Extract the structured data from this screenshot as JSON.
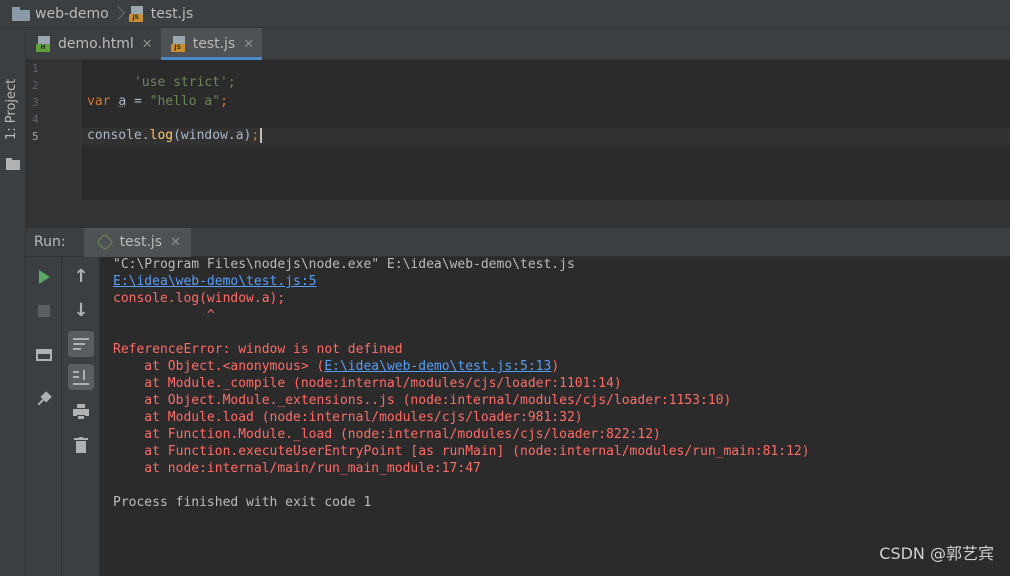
{
  "breadcrumb": {
    "project": "web-demo",
    "file": "test.js"
  },
  "left_strip": {
    "project_tab": "1: Project"
  },
  "editor_tabs": [
    {
      "label": "demo.html",
      "icon": "html-file-icon",
      "active": false
    },
    {
      "label": "test.js",
      "icon": "js-file-icon",
      "active": true
    }
  ],
  "editor": {
    "line_numbers": [
      "1",
      "2",
      "3",
      "4",
      "5"
    ],
    "current_line": "5",
    "lines": {
      "l1": "'use strict';",
      "l3_kw": "var",
      "l3_var": "a",
      "l3_op": " = ",
      "l3_str": "\"hello a\"",
      "l3_end": ";",
      "l5_obj": "console.",
      "l5_fn": "log",
      "l5_args": "(window.a)",
      "l5_end": ";"
    }
  },
  "run_panel": {
    "label": "Run:",
    "tab": "test.js",
    "toolbar_left": [
      "run-icon",
      "stop-icon",
      "layout-icon",
      "pin-icon"
    ],
    "toolbar_right": [
      "up-arrow-icon",
      "down-arrow-icon",
      "soft-wrap-icon",
      "scroll-to-end-icon",
      "print-icon",
      "trash-icon"
    ]
  },
  "console": {
    "cmd": "\"C:\\Program Files\\nodejs\\node.exe\" E:\\idea\\web-demo\\test.js",
    "link1": "E:\\idea\\web-demo\\test.js:5",
    "src": "console.log(window.a);",
    "caret": "            ^",
    "error": "ReferenceError: window is not defined",
    "at1_prefix": "    at Object.<anonymous> (",
    "at1_link": "E:\\idea\\web-demo\\test.js:5:13",
    "at1_suffix": ")",
    "at2": "    at Module._compile (node:internal/modules/cjs/loader:1101:14)",
    "at3": "    at Object.Module._extensions..js (node:internal/modules/cjs/loader:1153:10)",
    "at4": "    at Module.load (node:internal/modules/cjs/loader:981:32)",
    "at5": "    at Function.Module._load (node:internal/modules/cjs/loader:822:12)",
    "at6": "    at Function.executeUserEntryPoint [as runMain] (node:internal/modules/run_main:81:12)",
    "at7": "    at node:internal/main/run_main_module:17:47",
    "finish": "Process finished with exit code 1"
  },
  "watermark": "CSDN @郭艺宾",
  "colors": {
    "background": "#2b2b2b",
    "panel": "#3c3f41",
    "accent": "#4a88c7",
    "error": "#ff6b68",
    "link": "#589df6",
    "string": "#6a8759",
    "keyword": "#cc7832"
  }
}
